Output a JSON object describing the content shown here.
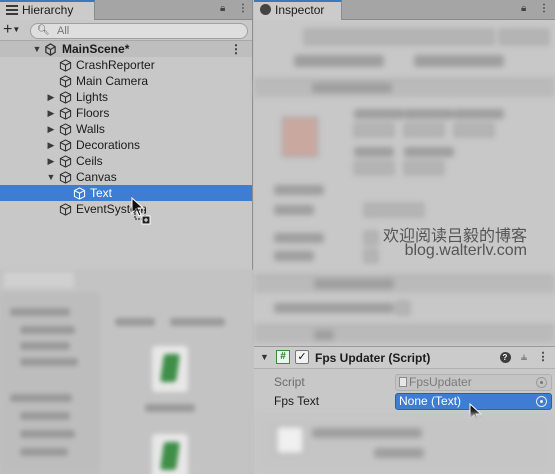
{
  "hierarchy": {
    "tab_title": "Hierarchy",
    "lock_icon": "lock-icon",
    "menu_icon": "kebab-menu-icon",
    "add_label": "+",
    "search_placeholder": "All",
    "scene": {
      "name": "MainScene*"
    },
    "items": [
      {
        "label": "CrashReporter",
        "depth": 1,
        "fold": "none"
      },
      {
        "label": "Main Camera",
        "depth": 1,
        "fold": "none"
      },
      {
        "label": "Lights",
        "depth": 1,
        "fold": "collapsed"
      },
      {
        "label": "Floors",
        "depth": 1,
        "fold": "collapsed"
      },
      {
        "label": "Walls",
        "depth": 1,
        "fold": "collapsed"
      },
      {
        "label": "Decorations",
        "depth": 1,
        "fold": "collapsed"
      },
      {
        "label": "Ceils",
        "depth": 1,
        "fold": "collapsed"
      },
      {
        "label": "Canvas",
        "depth": 1,
        "fold": "expanded"
      },
      {
        "label": "Text",
        "depth": 2,
        "fold": "none",
        "selected": true
      },
      {
        "label": "EventSystem",
        "depth": 1,
        "fold": "none"
      }
    ]
  },
  "inspector": {
    "tab_title": "Inspector",
    "watermark": {
      "line1": "欢迎阅读吕毅的博客",
      "line2": "blog.walterlv.com"
    },
    "component": {
      "title": "Fps Updater (Script)",
      "enabled": true,
      "script_label": "Script",
      "script_value": "FpsUpdater",
      "fps_text_label": "Fps Text",
      "fps_text_value": "None (Text)"
    }
  },
  "colors": {
    "selection": "#3e7dd2",
    "tab_accent": "#3a79bb",
    "panel_bg": "#c8c8c8"
  }
}
